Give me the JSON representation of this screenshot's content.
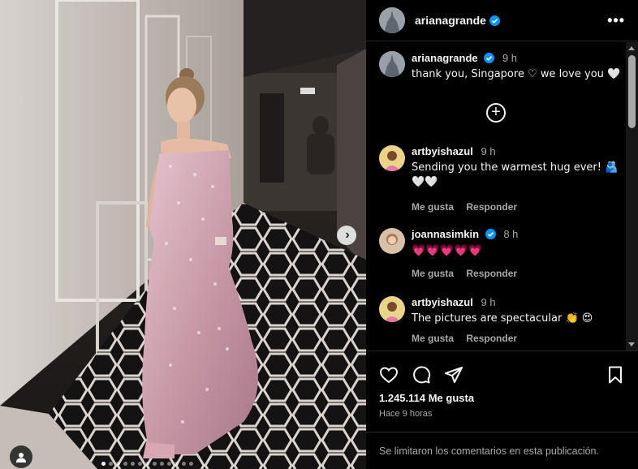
{
  "post": {
    "author": "arianagrande",
    "image_alt": "Woman in pink sequined strapless gown standing in a hotel hallway",
    "carousel": {
      "total_slides": 13,
      "current_slide": 1
    }
  },
  "caption": {
    "username": "arianagrande",
    "time": "9 h",
    "text": "thank you, Singapore ♡ we love you 🤍"
  },
  "comments": [
    {
      "username": "artbyishazul",
      "time": "9 h",
      "text": "Sending you the warmest hug ever! 🫂 🤍🤍",
      "like_label": "Me gusta",
      "reply_label": "Responder"
    },
    {
      "username": "joannasimkin",
      "verified": true,
      "time": "8 h",
      "text": "💗💗💗💗💗",
      "like_label": "Me gusta",
      "reply_label": "Responder"
    },
    {
      "username": "artbyishazul",
      "time": "9 h",
      "text": "The pictures are spectacular 👏 😍",
      "like_label": "Me gusta",
      "reply_label": "Responder"
    }
  ],
  "stats": {
    "likes": "1.245.114 Me gusta",
    "time_ago": "Hace 9 horas"
  },
  "comments_limited": "Se limitaron los comentarios en esta publicación.",
  "icons": {
    "more": "more-options-icon",
    "like": "heart-icon",
    "comment": "comment-icon",
    "share": "share-icon",
    "save": "bookmark-icon",
    "next": "chevron-right-icon",
    "tag": "user-tag-icon",
    "load_more": "plus-circle-icon"
  },
  "colors": {
    "background": "#000000",
    "text": "#f5f5f5",
    "secondary": "#a8a8a8",
    "verified": "#0095f6",
    "divider": "#262626"
  }
}
